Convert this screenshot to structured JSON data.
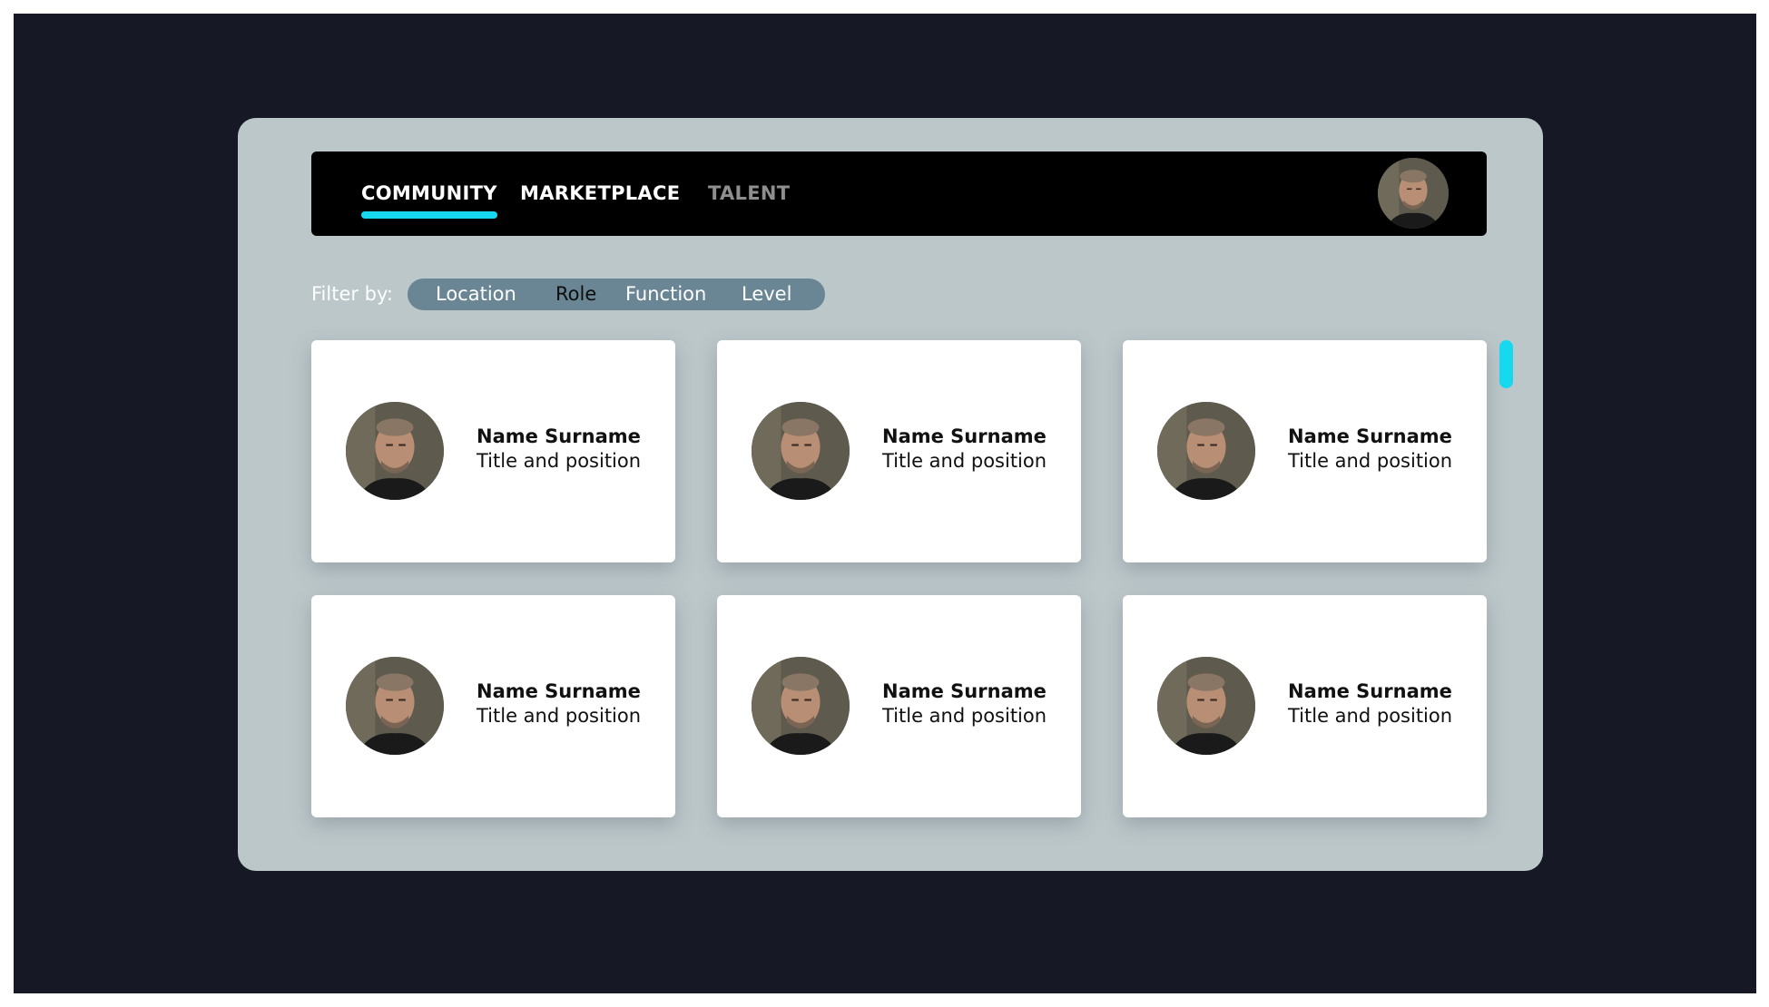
{
  "nav": {
    "tabs": [
      {
        "label": "COMMUNITY",
        "active": true
      },
      {
        "label": "MARKETPLACE",
        "active": false
      },
      {
        "label": "TALENT",
        "active": false
      }
    ],
    "accent_color": "#16d9f0",
    "profile_icon": "user-avatar-icon"
  },
  "filter": {
    "label": "Filter by:",
    "options": [
      {
        "label": "Location",
        "selected": false
      },
      {
        "label": "Role",
        "selected": true
      },
      {
        "label": "Function",
        "selected": false
      },
      {
        "label": "Level",
        "selected": false
      }
    ]
  },
  "cards": [
    {
      "name": "Name Surname",
      "title": "Title and position",
      "avatar": "profile-photo"
    },
    {
      "name": "Name Surname",
      "title": "Title and position",
      "avatar": "profile-photo"
    },
    {
      "name": "Name Surname",
      "title": "Title and position",
      "avatar": "profile-photo"
    },
    {
      "name": "Name Surname",
      "title": "Title and position",
      "avatar": "profile-photo"
    },
    {
      "name": "Name Surname",
      "title": "Title and position",
      "avatar": "profile-photo"
    },
    {
      "name": "Name Surname",
      "title": "Title and position",
      "avatar": "profile-photo"
    }
  ],
  "colors": {
    "backdrop": "#161825",
    "window": "#bcc7ca",
    "navbar": "#000000",
    "filter_pill": "#6a8694",
    "accent": "#16d9f0"
  }
}
